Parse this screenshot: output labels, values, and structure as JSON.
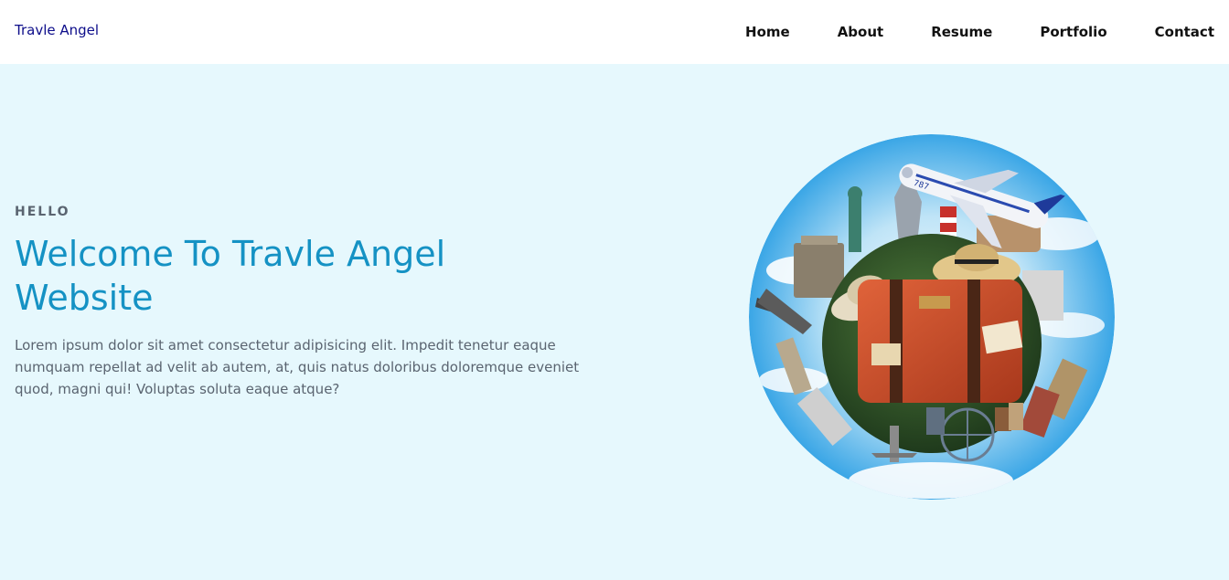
{
  "navbar": {
    "brand": "Travle Angel",
    "links": [
      {
        "label": "Home"
      },
      {
        "label": "About"
      },
      {
        "label": "Resume"
      },
      {
        "label": "Portfolio"
      },
      {
        "label": "Contact"
      }
    ]
  },
  "hero": {
    "kicker": "HELLO",
    "title": "Welcome To Travle Angel Website",
    "lead": "Lorem ipsum dolor sit amet consectetur adipisicing elit. Impedit tenetur eaque numquam repellat ad velit ab autem, at, quis natus doloribus doloremque eveniet quod, magni qui! Voluptas soluta eaque atque?",
    "image": {
      "icon": "travel-globe-illustration",
      "plane_text": "787"
    }
  },
  "colors": {
    "brand": "#0d0d8a",
    "title": "#1592c4",
    "hero_bg": "#e6f8fd",
    "text": "#5a6470"
  }
}
